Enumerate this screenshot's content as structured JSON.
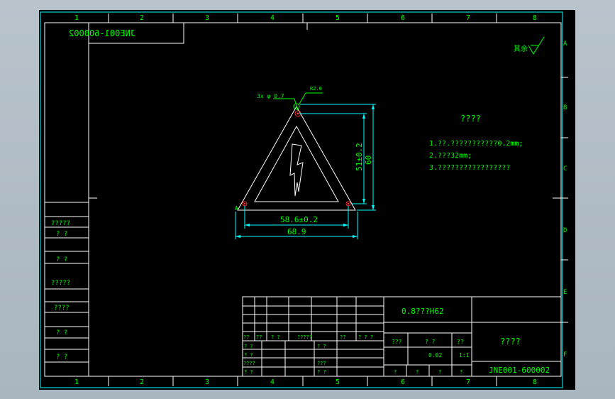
{
  "drawing": {
    "code_stamp": "JNE001-600002",
    "material": "0.8???H62",
    "part_name": "????",
    "drawing_no": "JNE001-600002",
    "notes_title": "????",
    "notes": [
      "1.??.???????????0.2mm;",
      "2.???32mm;",
      "3.?????????????????"
    ],
    "roughness_mark": "其余",
    "col_numbers_top": [
      "1",
      "2",
      "3",
      "4",
      "5",
      "6",
      "7",
      "8"
    ],
    "col_numbers_bottom": [
      "1",
      "2",
      "3",
      "4",
      "5",
      "6",
      "7",
      "8"
    ],
    "row_letters": [
      "A",
      "B",
      "C",
      "D",
      "E",
      "F"
    ]
  },
  "dimensions": {
    "height_inner": "51±0.2",
    "height_outer": "60",
    "width_inner": "58.6±0.2",
    "width_outer": "68.9",
    "hole_label": "3x φ 0.7",
    "top_label": "R2.0",
    "corner_label_left": "A"
  },
  "left_table": {
    "cells": [
      "?????",
      "? ?",
      "? ?",
      "?????",
      "????",
      "? ?",
      "? ?"
    ]
  },
  "title_block": {
    "row_labels_a": [
      "??",
      "??",
      "? ?",
      "?????",
      "??",
      "? ? ?"
    ],
    "row_labels_b": [
      "? ?",
      "? ?",
      "????",
      "? ?"
    ],
    "mid_labels": [
      "? ?",
      "???",
      "? ?"
    ],
    "scale_header": [
      "???",
      "? ?",
      "??"
    ],
    "scale_values": [
      "",
      "0.02",
      "1:1"
    ],
    "bottom_row": [
      "?",
      "?",
      "?",
      "?"
    ]
  }
}
